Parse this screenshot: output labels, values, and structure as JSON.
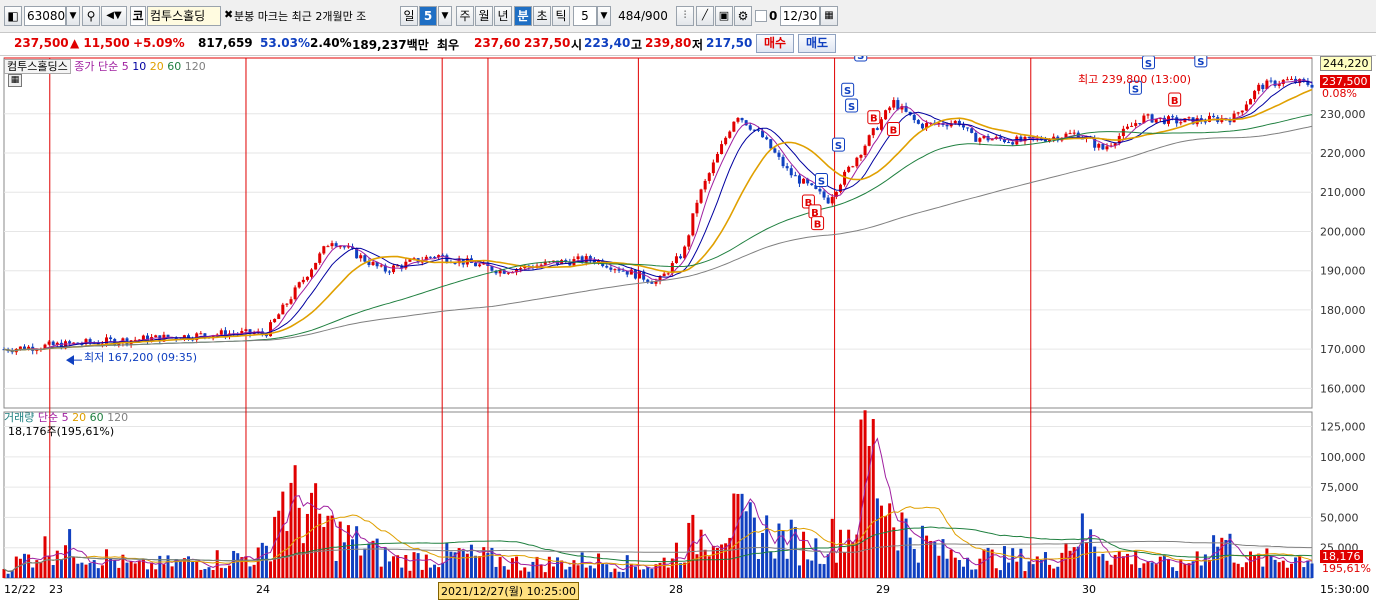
{
  "toolbar": {
    "code": "63080",
    "market_badge": "코",
    "name": "컴투스홀딩",
    "marker_label": "분봉 마크는 최근 2개월만 조",
    "periods": [
      "일",
      "5",
      "주",
      "월",
      "년",
      "분",
      "초",
      "틱"
    ],
    "selected_period": "분",
    "interval": "5",
    "page": "484/900",
    "checkbox_label": "0",
    "date": "12/30"
  },
  "quote": {
    "price": "237,500",
    "change": "▲ 11,500",
    "change_pct": "+5.09%",
    "volume": "817,659",
    "vol_ratio": "53.03%",
    "turnover_pct": "2.40%",
    "amount": "189,237백만",
    "bid_label": "최우",
    "ask_price": "237,60",
    "bid_price": "237,50",
    "open_label": "시",
    "open": "223,40",
    "high_label": "고",
    "high": "239,80",
    "low_label": "저",
    "low": "217,50",
    "buy_button": "매수",
    "sell_button": "매도"
  },
  "price_panel": {
    "name": "컴투스홀딩스",
    "indicator": "종가 단순",
    "ma_labels": [
      "5",
      "10",
      "20",
      "60",
      "120"
    ],
    "high_annotation": "최고 239,800 (13:00)",
    "low_annotation": "최저 167,200 (09:35)",
    "top_value": "244,220",
    "current_price": "237,500",
    "current_pct": "0.08%"
  },
  "volume_panel": {
    "title": "거래량",
    "indicator": "단순",
    "ma_labels": [
      "5",
      "20",
      "60",
      "120"
    ],
    "summary": "18,176주(195,61%)",
    "current_value": "18,176",
    "current_pct": "195,61%"
  },
  "x_axis": {
    "start": "12/22",
    "days": [
      "23",
      "24",
      "28",
      "29",
      "30"
    ],
    "cursor": "2021/12/27(월) 10:25:00",
    "end": "15:30:00"
  },
  "colors": {
    "up": "#e00000",
    "down": "#1040c0",
    "ma5": "#a020a0",
    "ma10": "#0000a0",
    "ma20": "#e0a000",
    "ma60": "#208040",
    "ma120": "#808080"
  },
  "chart_data": {
    "type": "candlestick",
    "title": "컴투스홀딩스",
    "price_ylim": [
      155000,
      244220
    ],
    "price_ticks": [
      160000,
      170000,
      180000,
      190000,
      200000,
      210000,
      220000,
      230000
    ],
    "volume_ylim": [
      0,
      137000
    ],
    "volume_ticks": [
      25000,
      50000,
      75000,
      100000,
      125000
    ],
    "anchors": {
      "x": [
        0,
        0.08,
        0.17,
        0.2,
        0.25,
        0.28,
        0.29,
        0.33,
        0.38,
        0.42,
        0.45,
        0.5,
        0.52,
        0.53,
        0.56,
        0.58,
        0.6,
        0.63,
        0.68,
        0.7,
        0.73,
        0.74,
        0.78,
        0.82,
        0.84,
        0.87,
        0.9,
        0.94,
        0.96,
        0.98,
        1.0
      ],
      "close": [
        170000,
        172000,
        174000,
        174000,
        198000,
        192000,
        190000,
        194000,
        190000,
        192000,
        193000,
        187000,
        195000,
        208000,
        230000,
        224000,
        215000,
        208000,
        233000,
        227000,
        228000,
        224000,
        223000,
        225000,
        221000,
        229000,
        228000,
        229000,
        237000,
        238500,
        237500
      ]
    },
    "volume_anchors": {
      "x": [
        0,
        0.04,
        0.1,
        0.2,
        0.21,
        0.23,
        0.25,
        0.3,
        0.35,
        0.4,
        0.45,
        0.5,
        0.52,
        0.55,
        0.58,
        0.62,
        0.65,
        0.66,
        0.67,
        0.69,
        0.72,
        0.8,
        0.82,
        0.85,
        0.9,
        0.93,
        0.95,
        1.0
      ],
      "volume": [
        8000,
        30000,
        10000,
        20000,
        70000,
        60000,
        40000,
        15000,
        20000,
        12000,
        15000,
        10000,
        30000,
        50000,
        40000,
        25000,
        45000,
        130000,
        80000,
        40000,
        20000,
        15000,
        40000,
        20000,
        10000,
        35000,
        15000,
        18176
      ]
    },
    "day_boundaries": [
      0.035,
      0.185,
      0.335,
      0.37,
      0.485,
      0.635,
      0.785
    ],
    "signals": [
      {
        "type": "S",
        "x": 0.655,
        "price": 245000
      },
      {
        "type": "S",
        "x": 0.645,
        "price": 236000
      },
      {
        "type": "S",
        "x": 0.648,
        "price": 232000
      },
      {
        "type": "S",
        "x": 0.638,
        "price": 222000
      },
      {
        "type": "S",
        "x": 0.625,
        "price": 213000
      },
      {
        "type": "B",
        "x": 0.615,
        "price": 207500
      },
      {
        "type": "B",
        "x": 0.62,
        "price": 205000
      },
      {
        "type": "B",
        "x": 0.622,
        "price": 202000
      },
      {
        "type": "B",
        "x": 0.665,
        "price": 229000
      },
      {
        "type": "B",
        "x": 0.68,
        "price": 226000
      },
      {
        "type": "S",
        "x": 0.865,
        "price": 236500
      },
      {
        "type": "S",
        "x": 0.875,
        "price": 243000
      },
      {
        "type": "S",
        "x": 0.915,
        "price": 243500
      },
      {
        "type": "B",
        "x": 0.895,
        "price": 233500
      }
    ]
  }
}
